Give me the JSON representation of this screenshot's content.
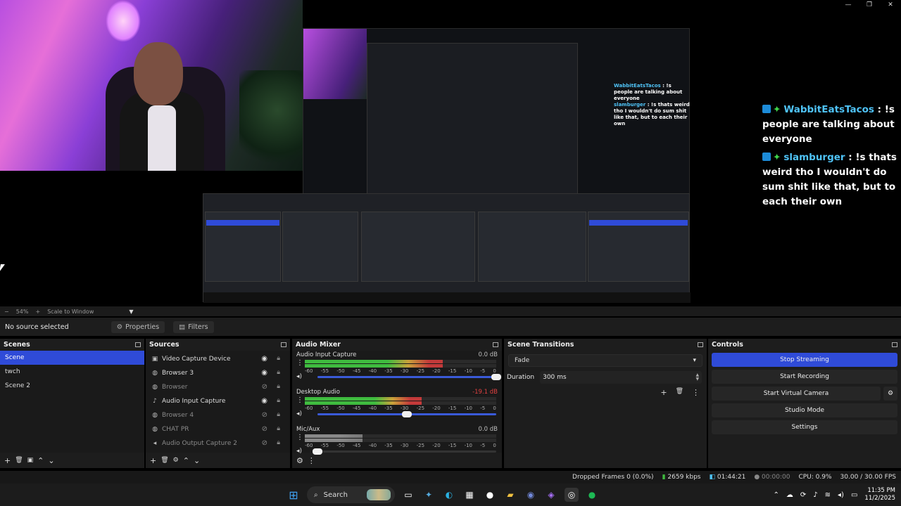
{
  "window_controls": {
    "minimize": "—",
    "maximize": "❐",
    "close": "✕"
  },
  "chat": [
    {
      "name": "WabbitEatsTacos",
      "text": ": !s people are talking about everyone"
    },
    {
      "name": "slamburger",
      "text": ": !s thats weird tho I wouldn't do sum shit like that, but to each their own"
    }
  ],
  "mini_chat": [
    {
      "name": "WabbitEatsTacos",
      "text": ": !s people are talking about everyone"
    },
    {
      "name": "slamburger",
      "text": ": !s thats weird tho I wouldn't do sum shit like that, but to each their own"
    }
  ],
  "zoom": {
    "minus": "−",
    "percent": "54%",
    "plus": "+",
    "mode": "Scale to Window",
    "caret": "▼"
  },
  "source_toolbar": {
    "status": "No source selected",
    "properties": "Properties",
    "filters": "Filters"
  },
  "scenes": {
    "title": "Scenes",
    "items": [
      {
        "label": "Scene",
        "selected": true
      },
      {
        "label": "twch",
        "selected": false
      },
      {
        "label": "Scene 2",
        "selected": false
      }
    ],
    "footer": [
      "+",
      "🗑",
      "▣",
      "⌃",
      "⌄"
    ]
  },
  "sources": {
    "title": "Sources",
    "items": [
      {
        "label": "Video Capture Device",
        "icon": "📷",
        "visible": true
      },
      {
        "label": "Browser 3",
        "icon": "◉",
        "visible": true
      },
      {
        "label": "Browser",
        "icon": "◉",
        "visible": false
      },
      {
        "label": "Audio Input Capture",
        "icon": "🎙",
        "visible": true
      },
      {
        "label": "Browser 4",
        "icon": "◉",
        "visible": false
      },
      {
        "label": "CHAT PR",
        "icon": "◉",
        "visible": false
      },
      {
        "label": "Audio Output Capture 2",
        "icon": "🔈",
        "visible": false
      }
    ],
    "footer": [
      "+",
      "🗑",
      "⚙",
      "⌃",
      "⌄"
    ]
  },
  "audio_mixer": {
    "title": "Audio Mixer",
    "channels": [
      {
        "name": "Audio Input Capture",
        "db": "0.0 dB",
        "level": 0.72,
        "volume": 1.0,
        "muted_style": false,
        "red": false
      },
      {
        "name": "Desktop Audio",
        "db": "-19.1 dB",
        "level": 0.61,
        "volume": 0.5,
        "muted_style": false,
        "red": true
      },
      {
        "name": "Mic/Aux",
        "db": "0.0 dB",
        "level": 0.3,
        "volume": 0.0,
        "muted_style": true,
        "red": false
      }
    ],
    "ticks": [
      "-60",
      "-55",
      "-50",
      "-45",
      "-40",
      "-35",
      "-30",
      "-25",
      "-20",
      "-15",
      "-10",
      "-5",
      "0"
    ],
    "footer": [
      "⚙",
      "⋮"
    ]
  },
  "scene_transitions": {
    "title": "Scene Transitions",
    "transition": "Fade",
    "duration_label": "Duration",
    "duration_value": "300 ms",
    "buttons": [
      "+",
      "🗑",
      "⋮"
    ]
  },
  "controls": {
    "title": "Controls",
    "buttons": [
      "Stop Streaming",
      "Start Recording",
      "Start Virtual Camera",
      "Studio Mode",
      "Settings"
    ],
    "gear": "⚙"
  },
  "status_bar": {
    "dropped": "Dropped Frames 0 (0.0%)",
    "bitrate": "2659 kbps",
    "stream_time": "01:44:21",
    "rec_time": "00:00:00",
    "cpu": "CPU: 0.9%",
    "fps": "30.00 / 30.00 FPS"
  },
  "taskbar": {
    "search": "Search",
    "time": "11:35 PM",
    "date": "11/2/2025"
  },
  "colors": {
    "accent": "#2f4bd8",
    "chat_name": "#4fc3f7",
    "chat_star": "#3fd44a"
  }
}
